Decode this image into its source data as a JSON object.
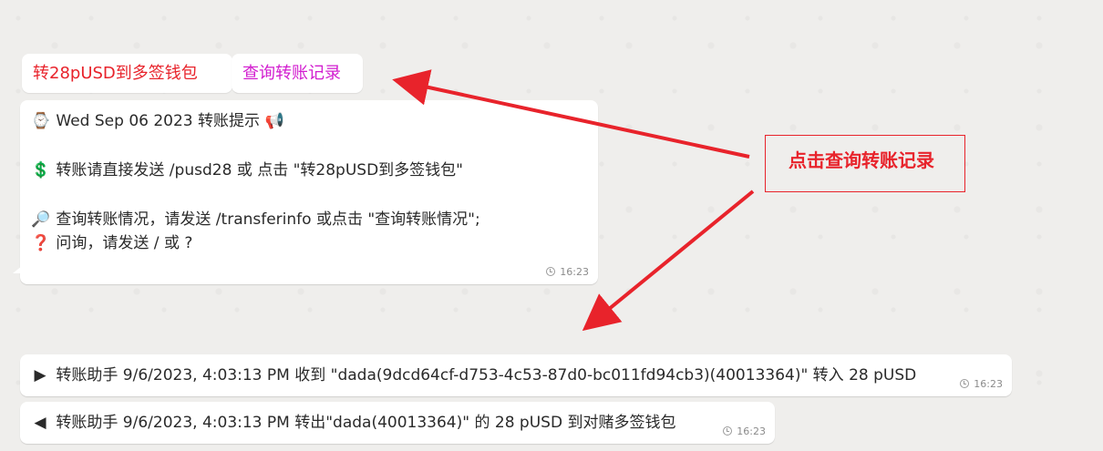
{
  "keyboard": {
    "transfer_button": "转28pUSD到多签钱包",
    "query_button": "查询转账记录"
  },
  "main_message": {
    "line1_icon": "⌚",
    "line1_text": "Wed Sep 06 2023 转账提示",
    "line1_suffix_icon": "📢",
    "line2_icon": "💲",
    "line2_text": "转账请直接发送 /pusd28 或 点击 \"转28pUSD到多签钱包\"",
    "line3_icon": "🔎",
    "line3_text": "查询转账情况，请发送 /transferinfo 或点击 \"查询转账情况\";",
    "line4_icon": "❓",
    "line4_text": "问询，请发送 / 或 ?",
    "time": "16:23"
  },
  "log_messages": [
    {
      "icon": "▶",
      "text": "转账助手 9/6/2023, 4:03:13 PM 收到 \"dada(9dcd64cf-d753-4c53-87d0-bc011fd94cb3)(40013364)\" 转入 28 pUSD",
      "time": "16:23"
    },
    {
      "icon": "◀",
      "text": "转账助手 9/6/2023, 4:03:13 PM 转出\"dada(40013364)\" 的 28 pUSD 到对赌多签钱包",
      "time": "16:23"
    }
  ],
  "annotation": {
    "text": "点击查询转账记录"
  },
  "colors": {
    "accent_red": "#e8232b",
    "accent_pink": "#d21ccf",
    "bubble_bg": "#ffffff",
    "chat_bg": "#efeeec"
  }
}
